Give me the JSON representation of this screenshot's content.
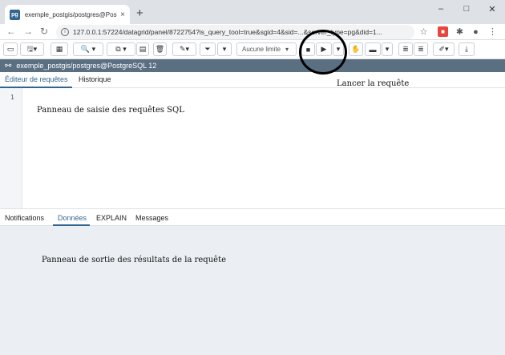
{
  "browser": {
    "tab_title": "exemple_postgis/postgres@Post",
    "favicon_text": "pg",
    "tab_close": "×",
    "new_tab": "+",
    "url": "127.0.0.1:57224/datagrid/panel/8722754?is_query_tool=true&sgid=4&sid=...&server_type=pg&did=1...",
    "window_controls": [
      "–",
      "□",
      "✕"
    ]
  },
  "toolbar": {
    "limit_select": "Aucune limite"
  },
  "connection": {
    "label": "exemple_postgis/postgres@PostgreSQL 12"
  },
  "editor_tabs": [
    {
      "label": "Éditeur de requêtes",
      "active": true
    },
    {
      "label": "Historique",
      "active": false
    }
  ],
  "editor": {
    "line_numbers": [
      "1"
    ],
    "annotation": "Panneau de saisie des requêtes SQL"
  },
  "callout": {
    "run_label": "Lancer la requête"
  },
  "result_tabs": [
    {
      "label": "Notifications",
      "active": false
    },
    {
      "label": "Données",
      "active": true
    },
    {
      "label": "EXPLAIN",
      "active": false
    },
    {
      "label": "Messages",
      "active": false
    }
  ],
  "results": {
    "annotation": "Panneau de sortie des résultats de la requête"
  },
  "colors": {
    "accent": "#326690",
    "connection_bar": "#5a6f82",
    "results_bg": "#ebeef3"
  }
}
